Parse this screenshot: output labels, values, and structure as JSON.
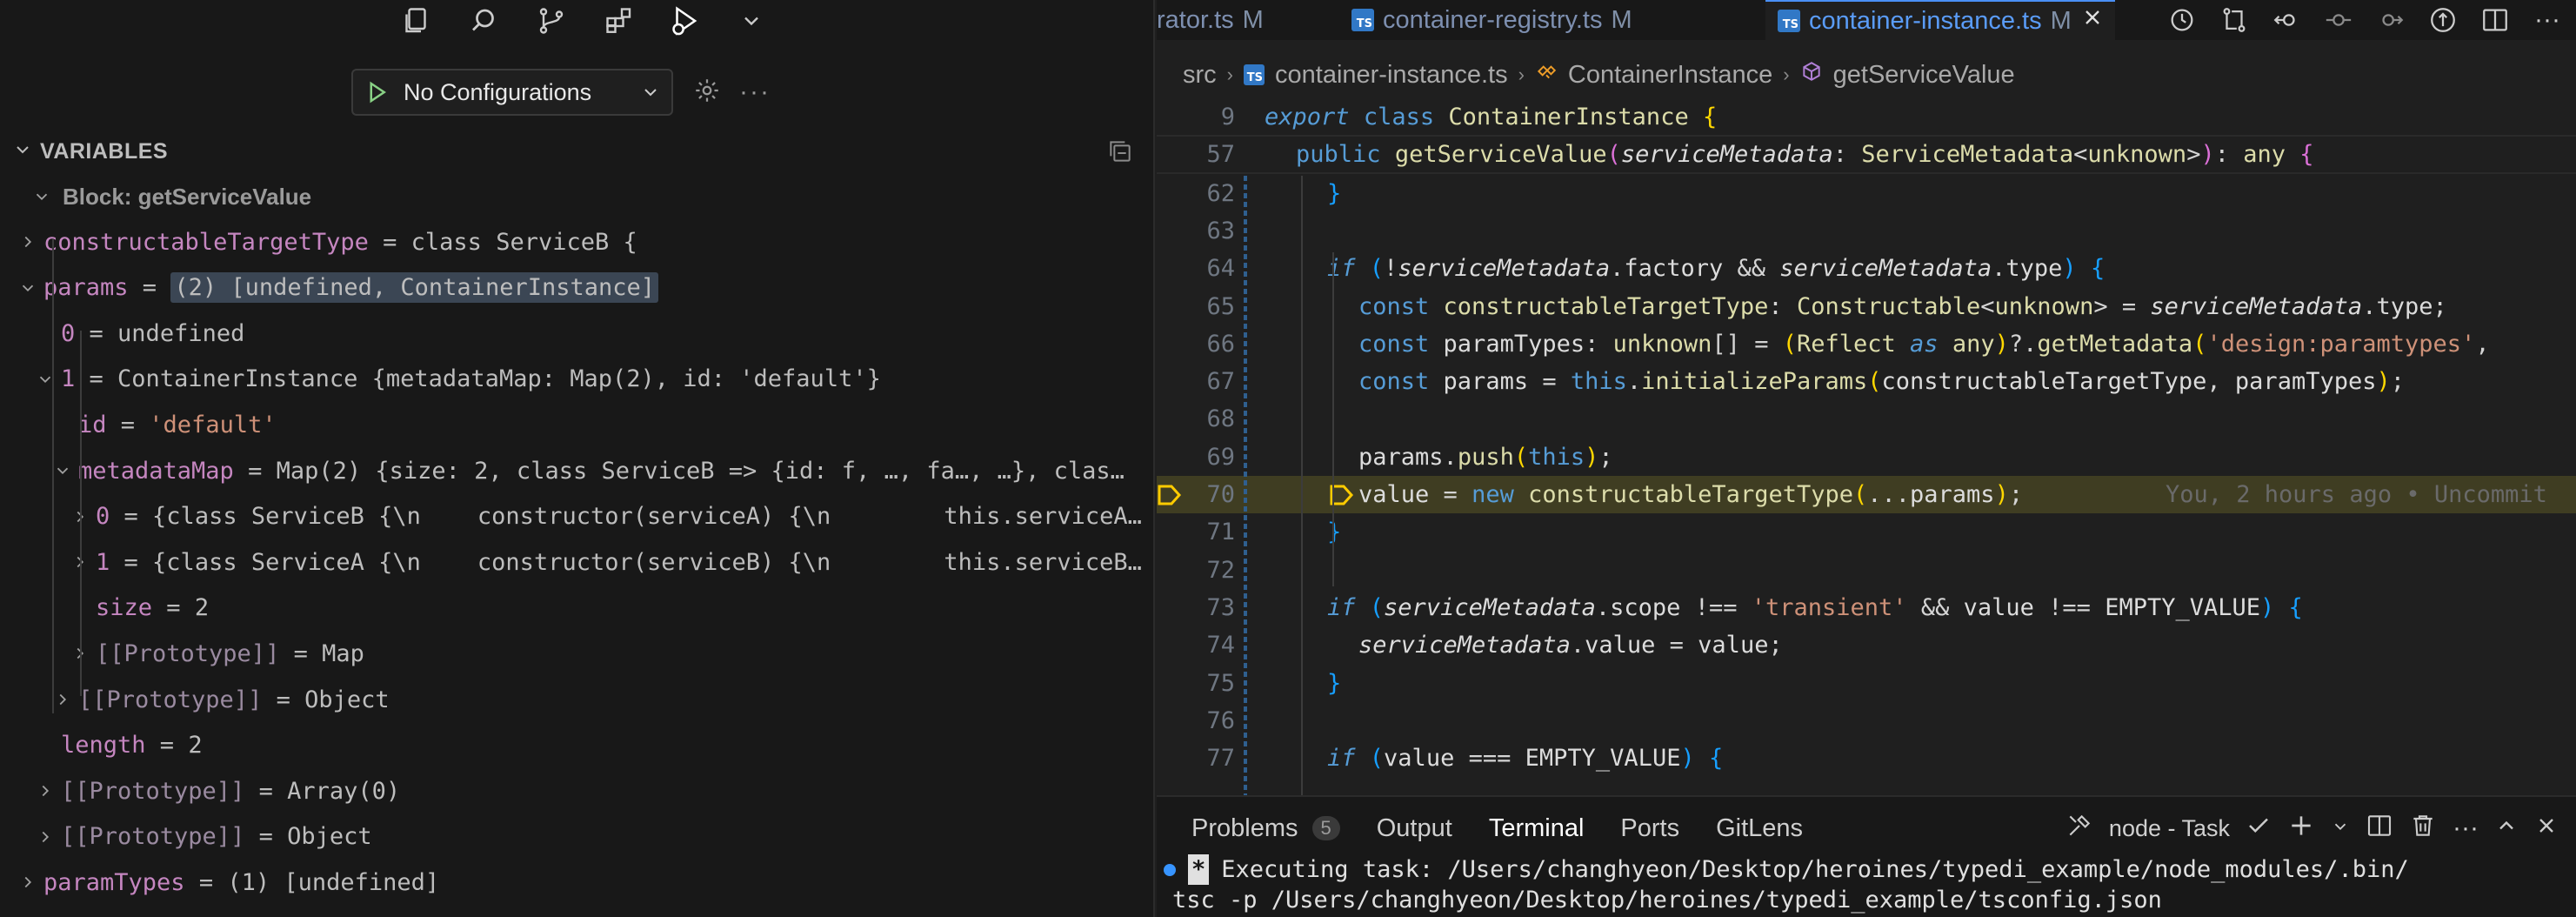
{
  "debug": {
    "config_label": "No Configurations",
    "variables_title": "VARIABLES",
    "block_label": "Block: getServiceValue",
    "rows": [
      {
        "indent": 0,
        "expand": "right",
        "name": "constructableTargetType",
        "eq": " = ",
        "value": "class ServiceB {",
        "vclass": "v"
      },
      {
        "indent": 0,
        "expand": "down",
        "name": "params",
        "eq": " = ",
        "value": "(2) [undefined, ContainerInstance]",
        "vclass": "v hl"
      },
      {
        "indent": 1,
        "expand": "none",
        "name": "0",
        "eq": " = ",
        "value": "undefined",
        "vclass": "v"
      },
      {
        "indent": 1,
        "expand": "down",
        "name": "1",
        "eq": " = ",
        "value": "ContainerInstance {metadataMap: Map(2), id: 'default'}",
        "vclass": "v"
      },
      {
        "indent": 2,
        "expand": "none",
        "name": "id",
        "eq": " = ",
        "value": "'default'",
        "vclass": "str"
      },
      {
        "indent": 2,
        "expand": "down",
        "name": "metadataMap",
        "eq": " = ",
        "value": "Map(2) {size: 2, class ServiceB => {id: f, …, fa…, …}, clas…",
        "vclass": "v"
      },
      {
        "indent": 3,
        "expand": "right",
        "name": "0",
        "eq": " = ",
        "value": "{class ServiceB {\\n    constructor(serviceA) {\\n        this.serviceA…",
        "vclass": "v"
      },
      {
        "indent": 3,
        "expand": "right",
        "name": "1",
        "eq": " = ",
        "value": "{class ServiceA {\\n    constructor(serviceB) {\\n        this.serviceB…",
        "vclass": "v"
      },
      {
        "indent": 3,
        "expand": "none",
        "name": "size",
        "eq": " = ",
        "value": "2",
        "vclass": "v"
      },
      {
        "indent": 3,
        "expand": "right",
        "name": "[[Prototype]]",
        "eq": " = ",
        "value": "Map",
        "vclass": "v",
        "proto": true
      },
      {
        "indent": 2,
        "expand": "right",
        "name": "[[Prototype]]",
        "eq": " = ",
        "value": "Object",
        "vclass": "v",
        "proto": true
      },
      {
        "indent": 1,
        "expand": "none",
        "name": "length",
        "eq": " = ",
        "value": "2",
        "vclass": "v"
      },
      {
        "indent": 1,
        "expand": "right",
        "name": "[[Prototype]]",
        "eq": " = ",
        "value": "Array(0)",
        "vclass": "v",
        "proto": true
      },
      {
        "indent": 1,
        "expand": "right",
        "name": "[[Prototype]]",
        "eq": " = ",
        "value": "Object",
        "vclass": "v",
        "proto": true
      },
      {
        "indent": 0,
        "expand": "right",
        "name": "paramTypes",
        "eq": " = ",
        "value": "(1) [undefined]",
        "vclass": "v"
      }
    ]
  },
  "tabs": [
    {
      "label": "rator.ts",
      "mod": "M",
      "icon": false
    },
    {
      "label": "container-registry.ts",
      "mod": "M",
      "icon": true,
      "icon_text": "TS"
    },
    {
      "label": "container-instance.ts",
      "mod": "M",
      "icon": true,
      "icon_text": "TS",
      "active": true
    }
  ],
  "breadcrumb": {
    "root": "src",
    "file": "container-instance.ts",
    "file_icon": "TS",
    "class": "ContainerInstance",
    "method": "getServiceValue"
  },
  "code": {
    "lines": [
      {
        "n": "9",
        "sticky": true,
        "indent": 0,
        "html": "<span class='kw2'>export</span> <span class='kw'>class</span> <span class='ty'>ContainerInstance</span> <span class='br'>{</span>"
      },
      {
        "n": "57",
        "sticky": true,
        "indent": 1,
        "html": "<span class='kw'>public</span> <span class='fn'>getServiceValue</span><span class='br2'>(</span><span class='pr'>serviceMetadata</span><span class='op'>: </span><span class='ty'>ServiceMetadata</span><span class='op'>&lt;</span><span class='ty'>unknown</span><span class='op'>&gt;</span><span class='br2'>)</span><span class='op'>: </span><span class='ty'>any</span> <span class='br2'>{</span>"
      },
      {
        "n": "62",
        "indent": 2,
        "html": "<span class='br3'>}</span>"
      },
      {
        "n": "63",
        "indent": 0,
        "html": ""
      },
      {
        "n": "64",
        "indent": 2,
        "html": "<span class='ctl'>if</span> <span class='br3'>(</span><span class='op'>!</span><span class='pr'>serviceMetadata</span><span class='op'>.</span><span class='vr'>factory</span> <span class='op'>&amp;&amp;</span> <span class='pr'>serviceMetadata</span><span class='op'>.</span><span class='vr'>type</span><span class='br3'>)</span> <span class='br3'>{</span>"
      },
      {
        "n": "65",
        "indent": 3,
        "html": "<span class='kw'>const</span> <span class='ty'>constructableTargetType</span><span class='op'>: </span><span class='ty'>Constructable</span><span class='op'>&lt;</span><span class='ty'>unknown</span><span class='op'>&gt; = </span><span class='pr'>serviceMetadata</span><span class='op'>.</span><span class='vr'>type</span><span class='op'>;</span>"
      },
      {
        "n": "66",
        "indent": 3,
        "html": "<span class='kw'>const</span> <span class='vr'>paramTypes</span><span class='op'>: </span><span class='ty'>unknown</span><span class='op'>[] = </span><span class='br'>(</span><span class='ty'>Reflect</span> <span class='kw2'>as</span> <span class='ty'>any</span><span class='br'>)</span><span class='op'>?.</span><span class='fn'>getMetadata</span><span class='br'>(</span><span class='s'>'design:paramtypes'</span><span class='op'>,</span>"
      },
      {
        "n": "67",
        "indent": 3,
        "html": "<span class='kw'>const</span> <span class='vr'>params</span> <span class='op'>= </span><span class='kw'>this</span><span class='op'>.</span><span class='fn'>initializeParams</span><span class='br'>(</span><span class='vr'>constructableTargetType</span><span class='op'>, </span><span class='vr'>paramTypes</span><span class='br'>)</span><span class='op'>;</span>"
      },
      {
        "n": "68",
        "indent": 0,
        "html": ""
      },
      {
        "n": "69",
        "indent": 3,
        "html": "<span class='vr'>params</span><span class='op'>.</span><span class='fn'>push</span><span class='br'>(</span><span class='kw'>this</span><span class='br'>)</span><span class='op'>;</span>"
      },
      {
        "n": "70",
        "indent": 3,
        "current": true,
        "html": "<span class='vr'>value</span> <span class='op'>= </span><span class='kw'>new</span> <span class='ty'>constructableTargetType</span><span class='br'>(</span><span class='op'>...</span><span class='vr'>params</span><span class='br'>)</span><span class='op'>;</span>"
      },
      {
        "n": "71",
        "indent": 2,
        "html": "<span class='br3'>}</span>"
      },
      {
        "n": "72",
        "indent": 0,
        "html": ""
      },
      {
        "n": "73",
        "indent": 2,
        "html": "<span class='ctl'>if</span> <span class='br3'>(</span><span class='pr'>serviceMetadata</span><span class='op'>.</span><span class='vr'>scope</span> <span class='op'>!==</span> <span class='s'>'transient'</span> <span class='op'>&amp;&amp;</span> <span class='vr'>value</span> <span class='op'>!==</span> <span class='vr'>EMPTY_VALUE</span><span class='br3'>)</span> <span class='br3'>{</span>"
      },
      {
        "n": "74",
        "indent": 3,
        "html": "<span class='pr'>serviceMetadata</span><span class='op'>.</span><span class='vr'>value</span> <span class='op'>= </span><span class='vr'>value</span><span class='op'>;</span>"
      },
      {
        "n": "75",
        "indent": 2,
        "html": "<span class='br3'>}</span>"
      },
      {
        "n": "76",
        "indent": 0,
        "html": ""
      },
      {
        "n": "77",
        "indent": 2,
        "html": "<span class='ctl'>if</span> <span class='br3'>(</span><span class='vr'>value</span> <span class='op'>===</span> <span class='vr'>EMPTY_VALUE</span><span class='br3'>)</span> <span class='br3'>{</span>"
      }
    ],
    "blame": "You, 2 hours ago • Uncommit"
  },
  "panel": {
    "tabs": [
      {
        "label": "Problems",
        "badge": "5"
      },
      {
        "label": "Output"
      },
      {
        "label": "Terminal",
        "active": true
      },
      {
        "label": "Ports"
      },
      {
        "label": "GitLens"
      }
    ],
    "task_label": "node - Task",
    "terminal_line1": "Executing task: /Users/changhyeon/Desktop/heroines/typedi_example/node_modules/.bin/",
    "terminal_line2": "tsc -p /Users/changhyeon/Desktop/heroines/typedi_example/tsconfig.json",
    "terminal_star": "*"
  },
  "colors": {
    "accent": "#4a8ff5",
    "breakpoint": "#ffcc00",
    "current_line": "#3f3d22"
  },
  "icons": {
    "activity": [
      "explorer-icon",
      "search-icon",
      "source-control-icon",
      "extensions-icon",
      "run-debug-icon",
      "chevron-down-icon"
    ],
    "tab_actions": [
      "timeline-icon",
      "compare-changes-icon",
      "go-back-icon",
      "previous-change-icon",
      "next-change-icon",
      "open-changes-icon",
      "split-editor-icon",
      "more-icon"
    ]
  }
}
